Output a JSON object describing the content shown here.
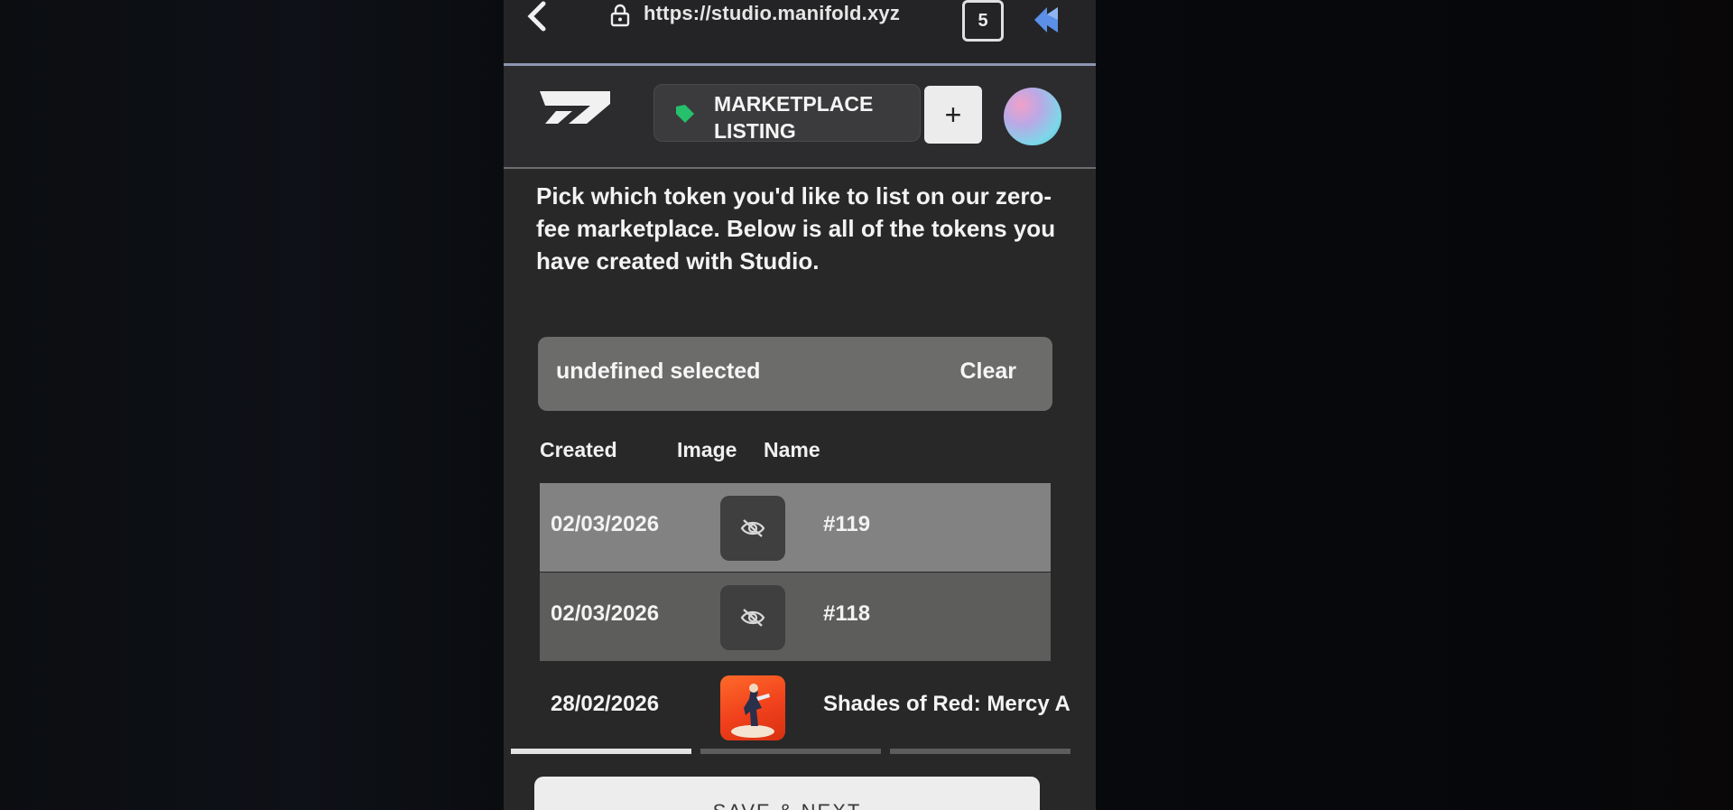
{
  "browser": {
    "url": "https://studio.manifold.xyz",
    "tab_count": "5",
    "icons": [
      "back-icon",
      "lock-icon",
      "extension-icon"
    ]
  },
  "header": {
    "listing_label": "MARKETPLACE LISTING",
    "add_label": "+",
    "icons": [
      "logo",
      "tag-icon",
      "avatar"
    ]
  },
  "intro": "Pick which token you'd like to list on our zero-fee marketplace. Below is all of the tokens you have created with Studio.",
  "selection": {
    "text": "undefined selected",
    "clear_label": "Clear"
  },
  "table": {
    "columns": [
      "Created",
      "Image",
      "Name"
    ],
    "rows": [
      {
        "created": "02/03/2026",
        "image": "hidden-eye-icon",
        "name": "#119"
      },
      {
        "created": "02/03/2026",
        "image": "hidden-eye-icon",
        "name": "#118"
      },
      {
        "created": "28/02/2026",
        "image": "thumbnail",
        "name": "Shades of Red: Mercy A"
      }
    ]
  },
  "progress": {
    "steps": 3,
    "active_step": 1
  },
  "footer": {
    "save_next_label": "SAVE & NEXT"
  },
  "colors": {
    "accent_green": "#25c06b",
    "pill_bg": "#3b3b3d",
    "selected_row": "#828282"
  }
}
